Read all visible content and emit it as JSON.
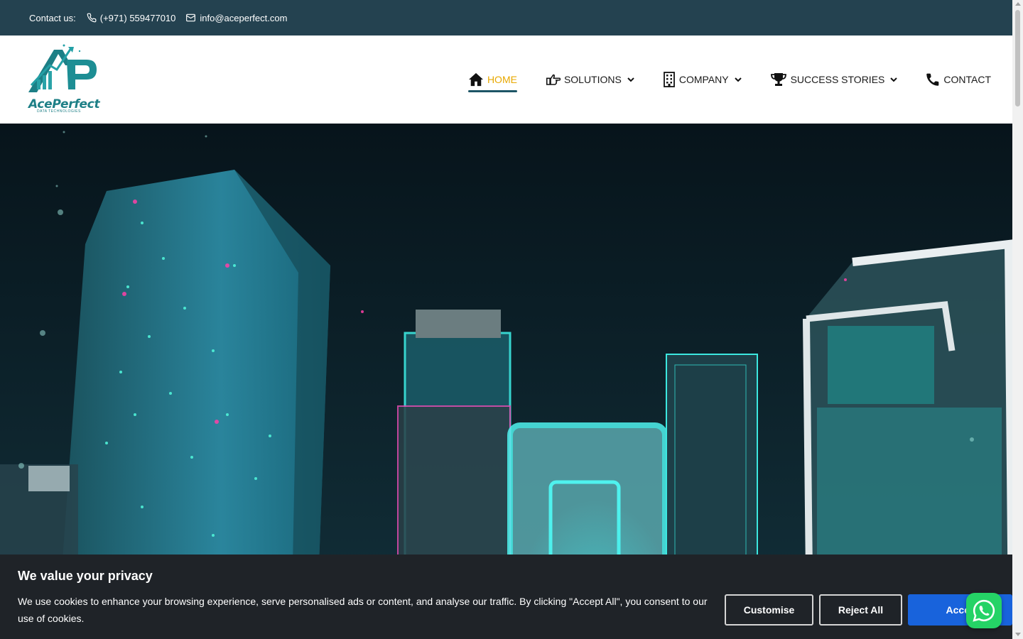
{
  "topbar": {
    "contact_label": "Contact us:",
    "phone": "(+971) 559477010",
    "email": "info@aceperfect.com"
  },
  "logo": {
    "name": "AcePerfect",
    "tagline": "DATA TECHNOLOGIES"
  },
  "nav": {
    "items": [
      {
        "label": "HOME",
        "icon": "home-icon",
        "active": true
      },
      {
        "label": "SOLUTIONS",
        "icon": "hand-pointing-icon",
        "dropdown": true
      },
      {
        "label": "COMPANY",
        "icon": "building-icon",
        "dropdown": true
      },
      {
        "label": "SUCCESS STORIES",
        "icon": "trophy-icon",
        "dropdown": true
      },
      {
        "label": "CONTACT",
        "icon": "phone-icon"
      }
    ]
  },
  "cookie": {
    "title": "We value your privacy",
    "text": "We use cookies to enhance your browsing experience, serve personalised ads or content, and analyse our traffic. By clicking \"Accept All\", you consent to our use of cookies.",
    "customise": "Customise",
    "reject": "Reject All",
    "accept": "Accept All"
  },
  "colors": {
    "topbar_bg": "#244250",
    "active_nav": "#e8a800",
    "accept_button": "#1863dc",
    "whatsapp": "#25d366",
    "brand": "#1d7f86"
  }
}
